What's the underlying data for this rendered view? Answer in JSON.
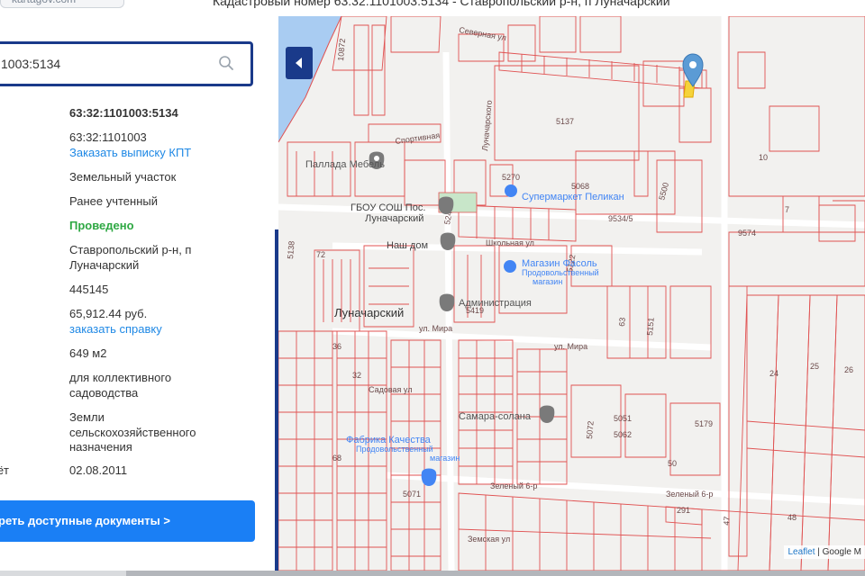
{
  "header": {
    "site": "kartagov.com",
    "title": "Кадастровый номер 63:32:1101003:5134 - Ставропольский р-н, п Луначарский"
  },
  "search": {
    "value": "1003:5134"
  },
  "details": [
    {
      "label": "",
      "value": "63:32:1101003:5134",
      "style": "bold"
    },
    {
      "label": "",
      "value": "63:32:1101003",
      "link": "Заказать выписку КПТ"
    },
    {
      "label": "",
      "value": "Земельный участок"
    },
    {
      "label": "",
      "value": "Ранее учтенный"
    },
    {
      "label": "",
      "value": "Проведено",
      "style": "green"
    },
    {
      "label": "",
      "value": "Ставропольский р-н, п Луначарский"
    },
    {
      "label": "",
      "value": "445145"
    },
    {
      "label": "",
      "value": "65,912.44 руб.",
      "link": "заказать справку"
    },
    {
      "label": "",
      "value": "649 м2"
    },
    {
      "label": "",
      "value": "для коллективного садоводства"
    },
    {
      "label": "",
      "value": "Земли сельскохозяйственного назначения"
    },
    {
      "label": "ёт",
      "value": "02.08.2011"
    }
  ],
  "docs_button": "реть доступные документы >",
  "map": {
    "labels": {
      "l10872": "10872",
      "severnaya": "Северная ул",
      "spotivnaya": "Спортивная",
      "lunacharskogo": "Луначарского",
      "l5137": "5137",
      "l10": "10",
      "l5270": "5270",
      "l5068": "5068",
      "l5500": "5500",
      "l9534": "9534/5",
      "l9574": "9574",
      "shkolnaya": "Школьная ул",
      "l5138": "5138",
      "l5240": "5240",
      "l72": "72",
      "l5122": "5122",
      "l5419": "5419",
      "l63": "63",
      "l5151": "5151",
      "mira": "ул. Мира",
      "l5072": "5072",
      "l5051": "5051",
      "l5062": "5062",
      "l5179": "5179",
      "l36": "36",
      "l32": "32",
      "l68": "68",
      "l50": "50",
      "l5071": "5071",
      "zeleniy": "Зеленый 6-р",
      "l291": "291",
      "l47": "47",
      "l48": "48",
      "l24": "24",
      "l25": "25",
      "l26": "26",
      "zemskaya": "Земская ул",
      "sadovaya": "Садовая ул",
      "l7": "7"
    },
    "pois": {
      "mebel": "Паллада Мебель",
      "school": "ГБОУ СОШ Пос.",
      "school2": "Луначарский",
      "pelikan": "Супермаркет Пеликан",
      "nash_dom": "Наш дом",
      "fasol": "Магазин Фасоль",
      "fasol_sub": "Продовольственный",
      "fasol_sub2": "магазин",
      "admin": "Администрация",
      "town": "Луначарский",
      "samara": "Самара-солана",
      "fabrika": "Фабрика Качества",
      "fabrika_sub": "Продовольственный",
      "fabrika_sub2": "магазин"
    },
    "attribution": {
      "leaflet": "Leaflet",
      "sep": " | ",
      "google": "Google M"
    }
  },
  "colors": {
    "accent": "#1a3a8a",
    "button": "#1a7ff5",
    "link": "#1e88e5",
    "success": "#2ea843",
    "parcel_line": "#e05252",
    "poi_blue": "#4285f4",
    "poi_gray": "#7a7a7a",
    "water": "#a9ccf2"
  }
}
